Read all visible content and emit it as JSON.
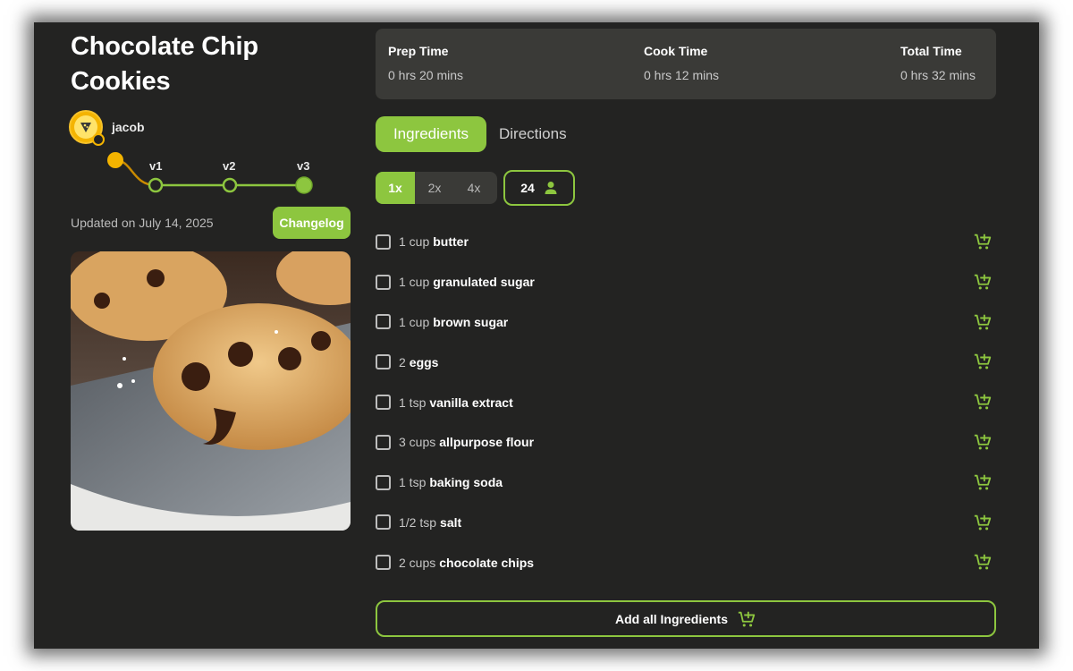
{
  "recipe": {
    "title": "Chocolate Chip Cookies",
    "author": "jacob",
    "updated": "Updated on July 14, 2025",
    "changelog_label": "Changelog",
    "versions": [
      "v1",
      "v2",
      "v3"
    ]
  },
  "times": [
    {
      "label": "Prep Time",
      "value": "0 hrs 20 mins"
    },
    {
      "label": "Cook Time",
      "value": "0 hrs 12 mins"
    },
    {
      "label": "Total Time",
      "value": "0 hrs 32 mins"
    }
  ],
  "tabs": {
    "ingredients": "Ingredients",
    "directions": "Directions",
    "active": "ingredients"
  },
  "scale": {
    "options": [
      "1x",
      "2x",
      "4x"
    ],
    "selected": "1x"
  },
  "servings": {
    "count": "24",
    "icon": "person-icon"
  },
  "ingredients": [
    {
      "qty": "1 cup",
      "name": "butter"
    },
    {
      "qty": "1 cup",
      "name": "granulated sugar"
    },
    {
      "qty": "1 cup",
      "name": "brown sugar"
    },
    {
      "qty": "2",
      "name": "eggs"
    },
    {
      "qty": "1 tsp",
      "name": "vanilla extract"
    },
    {
      "qty": "3 cups",
      "name": "allpurpose flour"
    },
    {
      "qty": "1 tsp",
      "name": "baking soda"
    },
    {
      "qty": "1/2 tsp",
      "name": "salt"
    },
    {
      "qty": "2 cups",
      "name": "chocolate chips"
    }
  ],
  "add_all_label": "Add all Ingredients",
  "colors": {
    "background": "#232322",
    "panel": "#3a3a37",
    "accent": "#8dc63f",
    "avatar": "#f4b400"
  },
  "icons": {
    "cart": "add-to-cart-icon",
    "avatar": "pizza-avatar-icon"
  }
}
